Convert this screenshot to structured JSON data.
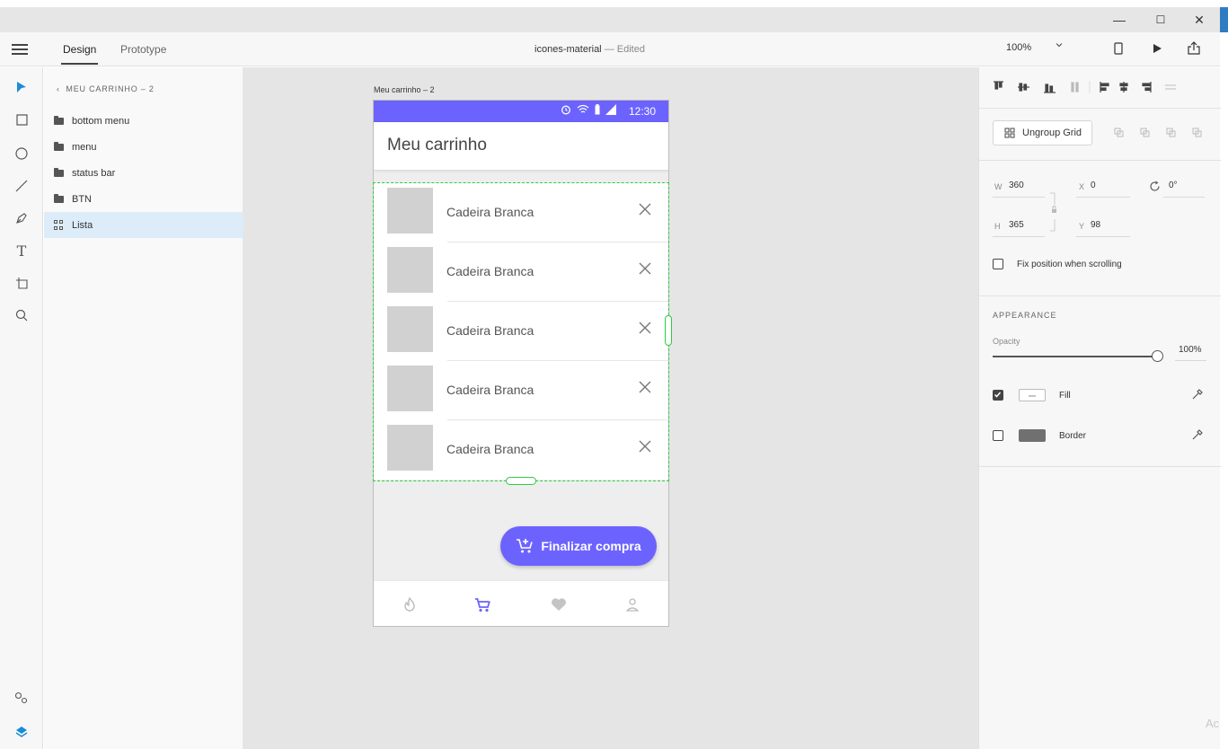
{
  "window": {
    "minimize": "—",
    "maximize": "☐",
    "close": "✕"
  },
  "menubar": {
    "tabs": [
      {
        "label": "Design",
        "active": true
      },
      {
        "label": "Prototype",
        "active": false
      }
    ],
    "document_title": "icones-material",
    "document_status": "— Edited",
    "zoom": "100%"
  },
  "tools": [
    "select-icon",
    "rectangle-icon",
    "ellipse-icon",
    "line-icon",
    "pen-icon",
    "text-icon",
    "artboard-icon",
    "zoom-icon",
    "assets-icon",
    "layers-icon"
  ],
  "layers": {
    "back_label": "MEU CARRINHO – 2",
    "items": [
      {
        "label": "bottom menu",
        "type": "folder",
        "selected": false
      },
      {
        "label": "menu",
        "type": "folder",
        "selected": false
      },
      {
        "label": "status bar",
        "type": "folder",
        "selected": false
      },
      {
        "label": "BTN",
        "type": "folder",
        "selected": false
      },
      {
        "label": "Lista",
        "type": "grid",
        "selected": true
      }
    ]
  },
  "canvas": {
    "artboard_label": "Meu carrinho – 2"
  },
  "mockup": {
    "status_time": "12:30",
    "appbar_title": "Meu carrinho",
    "items": [
      {
        "label": "Cadeira Branca"
      },
      {
        "label": "Cadeira Branca"
      },
      {
        "label": "Cadeira Branca"
      },
      {
        "label": "Cadeira Branca"
      },
      {
        "label": "Cadeira Branca"
      }
    ],
    "fab_label": "Finalizar compra",
    "nav": [
      "fire-icon",
      "cart-icon",
      "heart-icon",
      "person-icon"
    ],
    "accent": "#6c63ff"
  },
  "properties": {
    "ungroup_label": "Ungroup Grid",
    "w_label": "W",
    "w": "360",
    "h_label": "H",
    "h": "365",
    "x_label": "X",
    "x": "0",
    "y_label": "Y",
    "y": "98",
    "rotation": "0°",
    "fix_position_label": "Fix position when scrolling",
    "appearance_heading": "APPEARANCE",
    "opacity_label": "Opacity",
    "opacity": "100%",
    "fill_label": "Fill",
    "fill_checked": true,
    "border_label": "Border",
    "border_checked": false,
    "border_color": "#707070"
  },
  "watermark": "Ac"
}
